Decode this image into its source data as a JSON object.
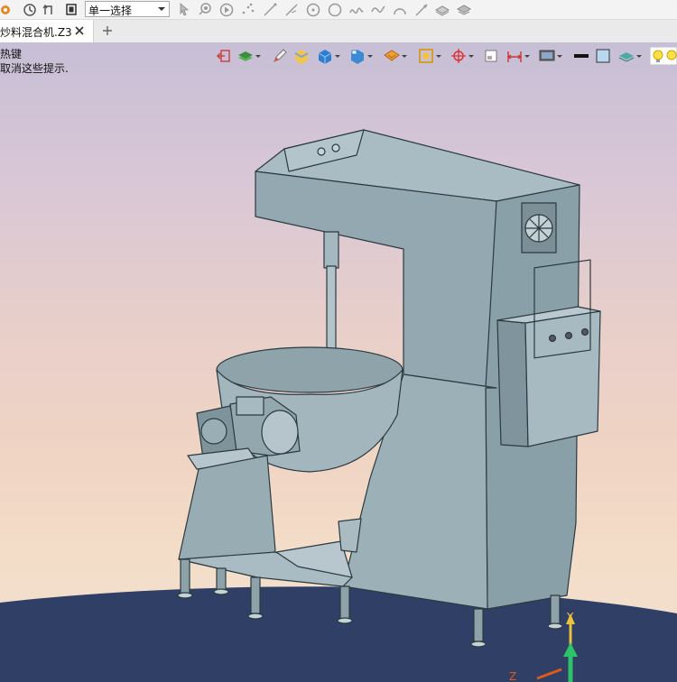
{
  "toolbar": {
    "selection_mode": "单一选择"
  },
  "tabs": [
    {
      "label": "炒料混合机.Z3"
    }
  ],
  "viewport": {
    "hint_line1": "热键",
    "hint_line2": "取消这些提示.",
    "axis_z": "Z",
    "axis_y": "Y",
    "colors": {
      "model_fill": "#9fb3bb",
      "model_edge": "#2b3a40",
      "ground": "#2f3f66"
    }
  }
}
